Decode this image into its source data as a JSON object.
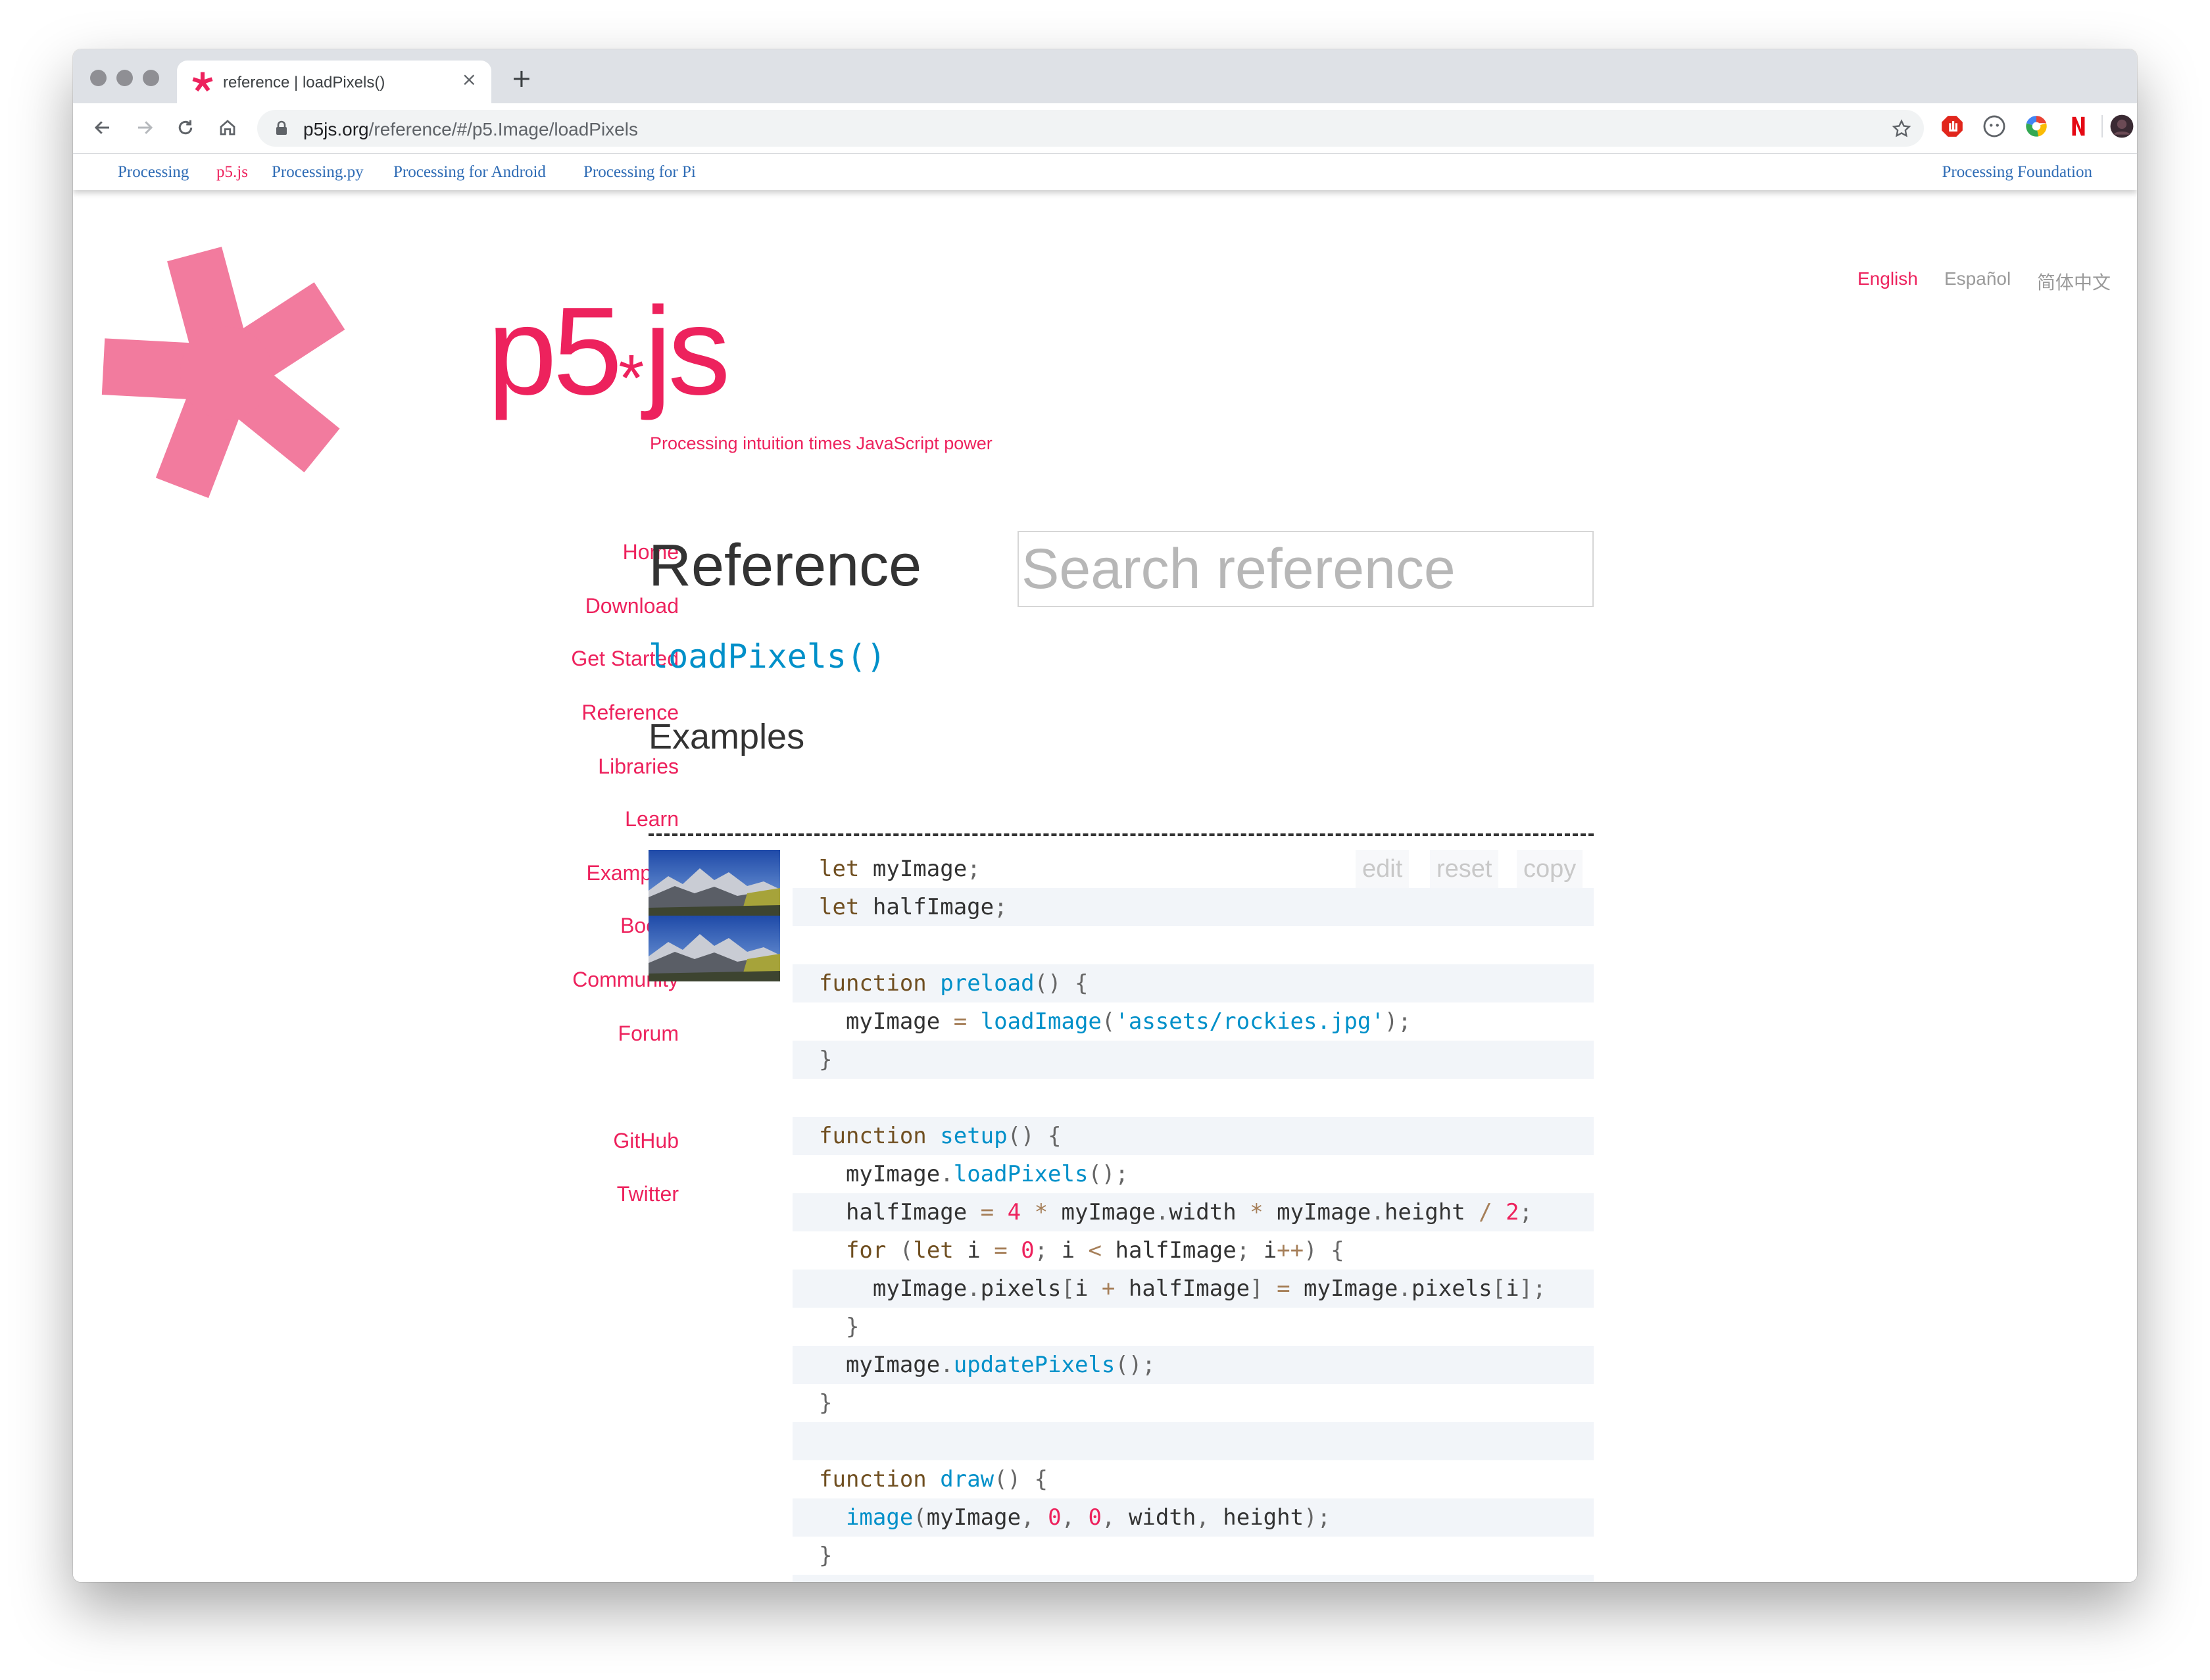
{
  "browser": {
    "tab_title": "reference | loadPixels()",
    "url_host": "p5js.org",
    "url_path": "/reference/#/p5.Image/loadPixels"
  },
  "processing_bar": {
    "links": [
      "Processing",
      "p5.js",
      "Processing.py",
      "Processing for Android",
      "Processing for Pi"
    ],
    "right_link": "Processing Foundation"
  },
  "languages": [
    "English",
    "Español",
    "简体中文"
  ],
  "brand": {
    "logo_text_left": "p5",
    "logo_text_mid": "*",
    "logo_text_right": "js",
    "tagline": "Processing intuition times JavaScript power",
    "accent_color": "#ed225d"
  },
  "sidebar": {
    "items": [
      "Home",
      "Download",
      "Get Started",
      "Reference",
      "Libraries",
      "Learn",
      "Examples",
      "Books",
      "Community",
      "Forum"
    ],
    "social": [
      "GitHub",
      "Twitter"
    ]
  },
  "main": {
    "title": "Reference",
    "search_placeholder": "Search reference",
    "function_name": "loadPixels()",
    "examples_heading": "Examples",
    "code_buttons": {
      "edit": "edit",
      "reset": "reset",
      "copy": "copy"
    },
    "code_lines": [
      "let myImage;",
      "let halfImage;",
      "",
      "function preload() {",
      "  myImage = loadImage('assets/rockies.jpg');",
      "}",
      "",
      "function setup() {",
      "  myImage.loadPixels();",
      "  halfImage = 4 * myImage.width * myImage.height / 2;",
      "  for (let i = 0; i < halfImage; i++) {",
      "    myImage.pixels[i + halfImage] = myImage.pixels[i];",
      "  }",
      "  myImage.updatePixels();",
      "}",
      "",
      "function draw() {",
      "  image(myImage, 0, 0, width, height);",
      "}"
    ]
  }
}
